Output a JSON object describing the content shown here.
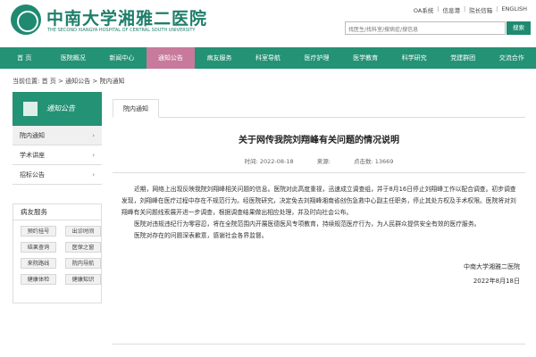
{
  "header": {
    "logo_cn": "中南大学湘雅二医院",
    "logo_en": "THE SECOND XIANGYA HOSPITAL OF CENTRAL SOUTH UNIVERSITY",
    "toplinks": [
      "OA系统",
      "信息港",
      "院长信箱",
      "ENGLISH"
    ],
    "search": {
      "placeholder": "找医生/找科室/搜病症/搜信息",
      "button": "搜索"
    }
  },
  "nav": {
    "items": [
      "首 页",
      "医院概况",
      "新闻中心",
      "通知公告",
      "病友服务",
      "科室导航",
      "医疗护理",
      "医学教育",
      "科学研究",
      "党建群团",
      "交流合作"
    ],
    "active_index": 3
  },
  "breadcrumb": "当前位置: 首 页 > 通知公告 > 院内通知",
  "sidebar": {
    "title": "通知公告",
    "items": [
      {
        "label": "院内通知",
        "active": true
      },
      {
        "label": "学术讲座",
        "active": false
      },
      {
        "label": "招标公告",
        "active": false
      }
    ]
  },
  "services": {
    "title": "病友服务",
    "items": [
      "预约挂号",
      "出诊时间",
      "结果查询",
      "医保之窗",
      "来院路线",
      "院内导航",
      "健康体检",
      "健康知识"
    ]
  },
  "content": {
    "tab": "院内通知",
    "title": "关于网传我院刘翔峰有关问题的情况说明",
    "meta": {
      "date": "时间: 2022-08-18",
      "source": "来源:",
      "views": "点击数: 13669"
    },
    "paragraphs": [
      "近期，网络上出现反映我院刘翔峰相关问题的信息。医院对此高度重视，迅速成立调查组，并于8月16日停止刘翔峰工作以配合调查。初步调查发现，刘翔峰在医疗过程中存在不规范行为。经医院研究，决定免去刘翔峰湘南省创伤急救中心副主任职务，停止其处方权及手术权限。医院将对刘翔峰有关问题线索展开进一步调查，根据调查结果做出相应处理，并及时向社会公布。",
      "医院对违规违纪行为零容忍，将在全院范围内开展医德医风专项教育，持续规范医疗行为，为人民群众提供安全有效的医疗服务。",
      "医院对存在的问题深表歉意，感谢社会各界监督。"
    ],
    "signature": "中南大学湘雅二医院",
    "date": "2022年8月18日"
  },
  "colors": {
    "primary": "#249274",
    "active": "#c77a9b"
  }
}
